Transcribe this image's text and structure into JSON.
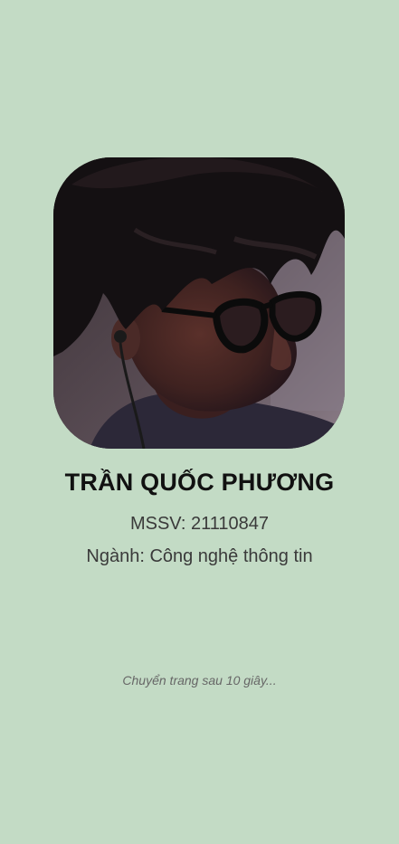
{
  "profile": {
    "name": "TRẦN QUỐC PHƯƠNG",
    "mssv": "MSSV: 21110847",
    "major": "Ngành: Công nghệ thông tin"
  },
  "footer": {
    "redirect_text": "Chuyển trang sau 10 giây..."
  },
  "colors": {
    "background": "#c3dbc5",
    "name_text": "#111111",
    "info_text": "#3a3a3a",
    "hint_text": "#666666"
  },
  "icons": {
    "avatar": "profile-photo"
  }
}
